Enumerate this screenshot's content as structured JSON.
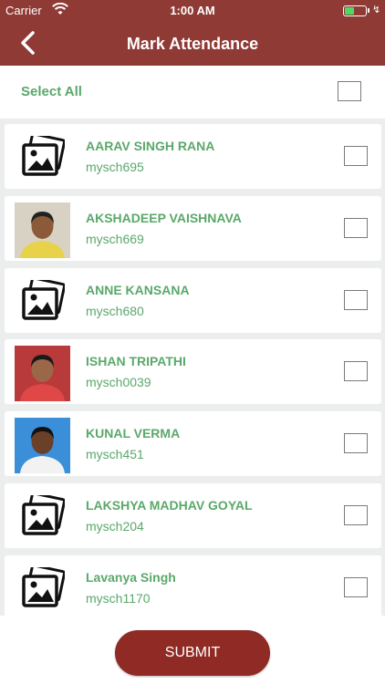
{
  "status_bar": {
    "carrier": "Carrier",
    "time": "1:00 AM",
    "battery_level": 0.45
  },
  "header": {
    "title": "Mark Attendance",
    "back_icon": "chevron-left-icon"
  },
  "select_all": {
    "label": "Select All",
    "checked": false
  },
  "students": [
    {
      "name": "AARAV SINGH RANA",
      "id": "mysch695",
      "photo": "image-placeholder-icon",
      "checked": false
    },
    {
      "name": "AKSHADEEP VAISHNAVA",
      "id": "mysch669",
      "photo": "student-photo",
      "checked": false
    },
    {
      "name": "ANNE KANSANA",
      "id": "mysch680",
      "photo": "image-placeholder-icon",
      "checked": false
    },
    {
      "name": "ISHAN TRIPATHI",
      "id": "mysch0039",
      "photo": "student-photo",
      "checked": false
    },
    {
      "name": "KUNAL VERMA",
      "id": "mysch451",
      "photo": "student-photo",
      "checked": false
    },
    {
      "name": "LAKSHYA MADHAV GOYAL",
      "id": "mysch204",
      "photo": "image-placeholder-icon",
      "checked": false
    },
    {
      "name": "Lavanya Singh",
      "id": "mysch1170",
      "photo": "image-placeholder-icon",
      "checked": false
    }
  ],
  "submit": {
    "label": "SUBMIT"
  },
  "colors": {
    "header": "#8f3a34",
    "accent_green": "#5aa86a",
    "button": "#8f2a24",
    "list_bg": "#eceded"
  }
}
